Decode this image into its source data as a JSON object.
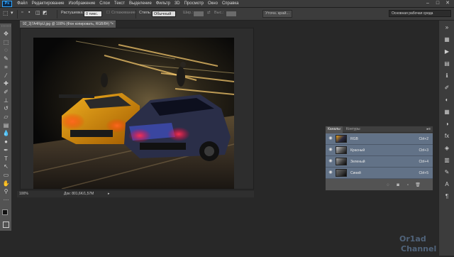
{
  "app": {
    "logo": "Ps"
  },
  "menu": [
    "Файл",
    "Редактирование",
    "Изображение",
    "Слои",
    "Текст",
    "Выделение",
    "Фильтр",
    "3D",
    "Просмотр",
    "Окно",
    "Справка"
  ],
  "window_controls": [
    "–",
    "□",
    "✕"
  ],
  "options": {
    "feather_label": "Растушевка:",
    "feather_value": "0 пикс.",
    "antialias_label": "Сглаживание",
    "style_label": "Стиль:",
    "style_value": "Обычный",
    "width_label": "Шир.:",
    "height_label": "Выс.:",
    "refine_button": "Уточн. край..."
  },
  "workspace": "Основная рабочая среда",
  "document": {
    "tab_title": "92_2j7A4RpU.jpg @ 100% (Фон копировать, RGB/8#) *",
    "close": "×",
    "zoom": "100%",
    "doc_info": "Док: 801,6K/1,57M",
    "arrow": "▸"
  },
  "tools": [
    {
      "name": "move-tool-icon",
      "glyph": "✥"
    },
    {
      "name": "marquee-tool-icon",
      "glyph": "⬚"
    },
    {
      "name": "lasso-tool-icon",
      "glyph": "◌"
    },
    {
      "name": "quick-select-tool-icon",
      "glyph": "✎"
    },
    {
      "name": "crop-tool-icon",
      "glyph": "⌗"
    },
    {
      "name": "eyedropper-tool-icon",
      "glyph": "⁄"
    },
    {
      "name": "healing-brush-tool-icon",
      "glyph": "✚"
    },
    {
      "name": "brush-tool-icon",
      "glyph": "✐"
    },
    {
      "name": "clone-stamp-tool-icon",
      "glyph": "⊥"
    },
    {
      "name": "history-brush-tool-icon",
      "glyph": "↺"
    },
    {
      "name": "eraser-tool-icon",
      "glyph": "▱"
    },
    {
      "name": "gradient-tool-icon",
      "glyph": "▤"
    },
    {
      "name": "blur-tool-icon",
      "glyph": "💧"
    },
    {
      "name": "dodge-tool-icon",
      "glyph": "●"
    },
    {
      "name": "pen-tool-icon",
      "glyph": "✒"
    },
    {
      "name": "type-tool-icon",
      "glyph": "T"
    },
    {
      "name": "path-select-tool-icon",
      "glyph": "↖"
    },
    {
      "name": "shape-tool-icon",
      "glyph": "▭"
    },
    {
      "name": "hand-tool-icon",
      "glyph": "✋"
    },
    {
      "name": "zoom-tool-icon",
      "glyph": "⚲"
    },
    {
      "name": "extra-tools-icon",
      "glyph": "···"
    }
  ],
  "right_icons": [
    {
      "name": "collapse-panels-icon",
      "glyph": "»"
    },
    {
      "name": "history-panel-icon",
      "glyph": "▦"
    },
    {
      "name": "actions-panel-icon",
      "glyph": "▶"
    },
    {
      "name": "properties-panel-icon",
      "glyph": "▤"
    },
    {
      "name": "info-panel-icon",
      "glyph": "ℹ"
    },
    {
      "name": "brush-panel-icon",
      "glyph": "✐"
    },
    {
      "name": "color-panel-icon",
      "glyph": "◐"
    },
    {
      "name": "swatches-panel-icon",
      "glyph": "▦"
    },
    {
      "name": "adjustments-panel-icon",
      "glyph": "◑"
    },
    {
      "name": "styles-panel-icon",
      "glyph": "fx"
    },
    {
      "name": "layers-panel-icon",
      "glyph": "◈"
    },
    {
      "name": "channels-panel-icon",
      "glyph": "▥"
    },
    {
      "name": "paths-panel-icon",
      "glyph": "✎"
    },
    {
      "name": "character-panel-icon",
      "glyph": "A"
    },
    {
      "name": "paragraph-panel-icon",
      "glyph": "¶"
    }
  ],
  "channels_panel": {
    "tab_channels": "Каналы",
    "tab_paths": "Контуры",
    "menu_icon": "▸≡",
    "rows": [
      {
        "name": "RGB",
        "key": "Ctrl+2"
      },
      {
        "name": "Красный",
        "key": "Ctrl+3"
      },
      {
        "name": "Зеленый",
        "key": "Ctrl+4"
      },
      {
        "name": "Синий",
        "key": "Ctrl+5"
      }
    ],
    "eye": "◉"
  },
  "watermark": {
    "line1": "Or1ad",
    "line2": "Channel"
  },
  "colors": {
    "accent": "#31a8ff",
    "selection": "#627287"
  }
}
